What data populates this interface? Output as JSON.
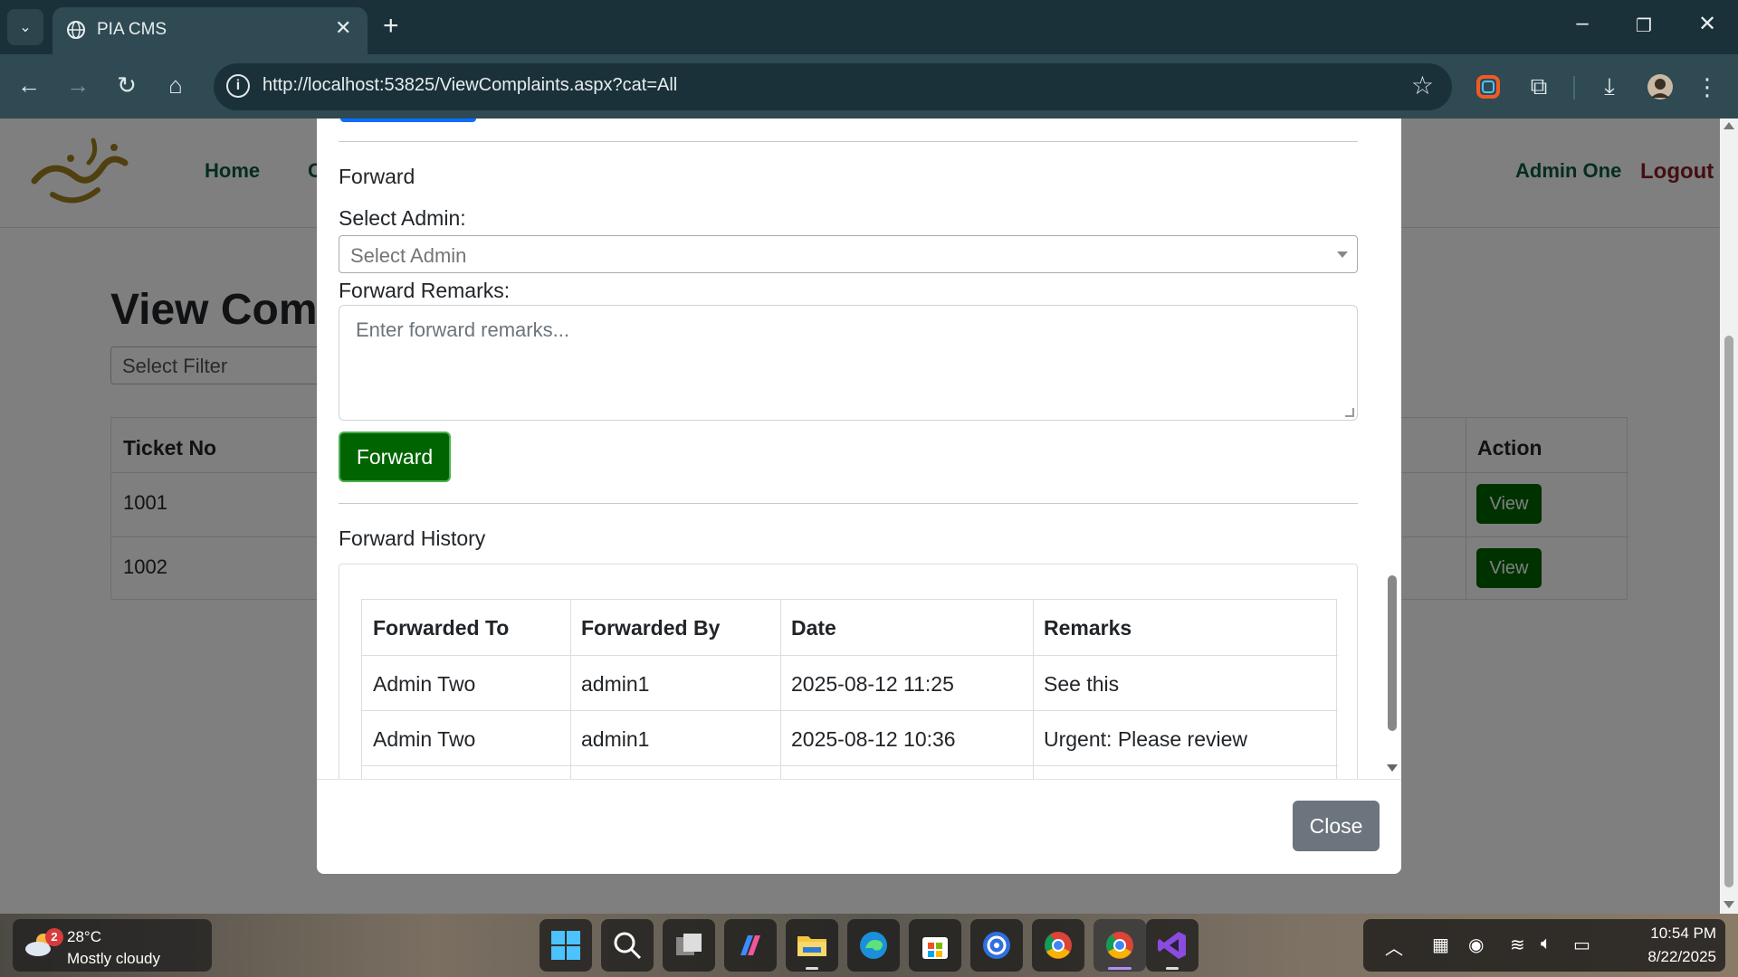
{
  "browser": {
    "tab_title": "PIA CMS",
    "url": "http://localhost:53825/ViewComplaints.aspx?cat=All"
  },
  "site": {
    "nav": [
      "Home",
      "C"
    ],
    "user": "Admin One",
    "logout": "Logout"
  },
  "page": {
    "title": "View Comp",
    "filter_placeholder": "Select Filter",
    "table": {
      "headers": [
        "Ticket No",
        "Action"
      ],
      "rows": [
        {
          "ticket": "1001",
          "action": "View"
        },
        {
          "ticket": "1002",
          "action": "View"
        }
      ]
    }
  },
  "modal": {
    "forward_heading": "Forward",
    "select_admin_label": "Select Admin:",
    "select_admin_placeholder": "Select Admin",
    "remarks_label": "Forward Remarks:",
    "remarks_placeholder": "Enter forward remarks...",
    "forward_button": "Forward",
    "history_heading": "Forward History",
    "history": {
      "headers": [
        "Forwarded To",
        "Forwarded By",
        "Date",
        "Remarks"
      ],
      "rows": [
        [
          "Admin Two",
          "admin1",
          "2025-08-12 11:25",
          "See this"
        ],
        [
          "Admin Two",
          "admin1",
          "2025-08-12 10:36",
          "Urgent: Please review"
        ]
      ]
    },
    "close_button": "Close"
  },
  "taskbar": {
    "weather_badge": "2",
    "weather_temp": "28°C",
    "weather_condition": "Mostly cloudy",
    "time": "10:54 PM",
    "date": "8/22/2025"
  },
  "colors": {
    "brand_green": "#006400",
    "nav_green": "#0b5a3a",
    "logout_red": "#8b1c22",
    "close_gray": "#6c757d",
    "chrome_dark": "#1b3139"
  }
}
